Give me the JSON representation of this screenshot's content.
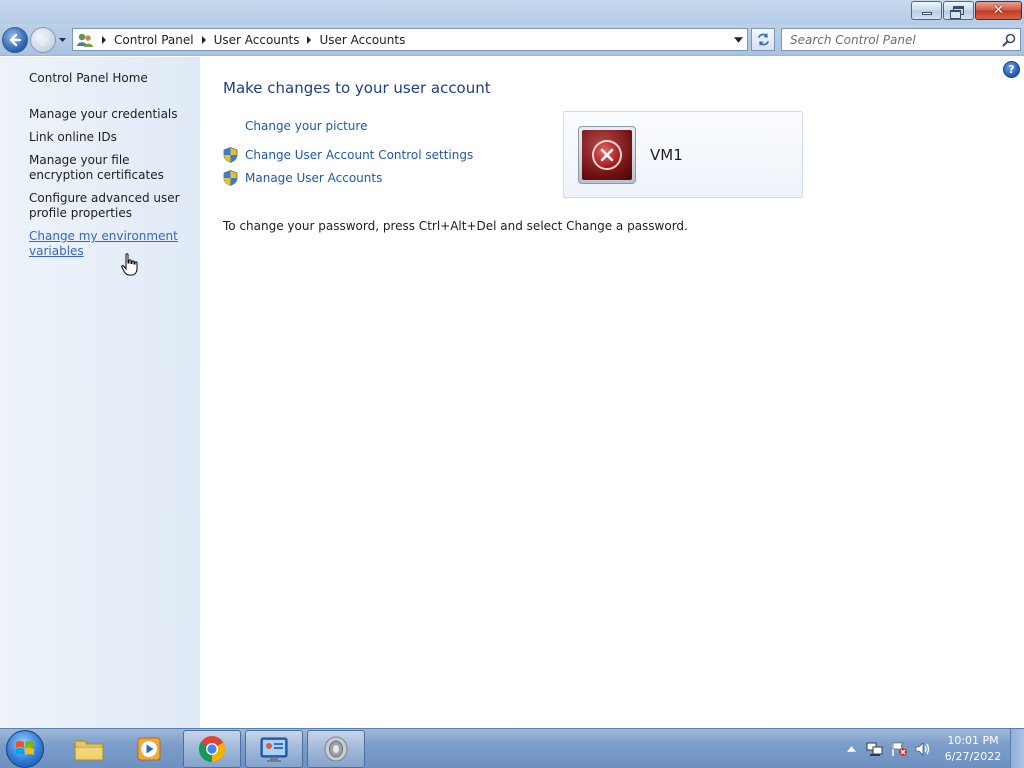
{
  "window": {
    "caption_buttons": {
      "minimize": "minimize",
      "maximize": "restore",
      "close": "close"
    }
  },
  "navigation": {
    "breadcrumbs": [
      "Control Panel",
      "User Accounts",
      "User Accounts"
    ],
    "search_placeholder": "Search Control Panel"
  },
  "sidebar": {
    "home_label": "Control Panel Home",
    "items": [
      {
        "label": "Manage your credentials"
      },
      {
        "label": "Link online IDs"
      },
      {
        "label": "Manage your file encryption certificates"
      },
      {
        "label": "Configure advanced user profile properties"
      },
      {
        "label": "Change my environment variables",
        "hovered": true
      }
    ]
  },
  "main": {
    "heading": "Make changes to your user account",
    "tasks": [
      {
        "label": "Change your picture",
        "shield": false
      },
      {
        "label": "Change User Account Control settings",
        "shield": true
      },
      {
        "label": "Manage User Accounts",
        "shield": true
      }
    ],
    "password_note": "To change your password, press Ctrl+Alt+Del and select Change a password.",
    "user": {
      "name": "VM1",
      "avatar_icon": "error-x-icon"
    }
  },
  "taskbar": {
    "pinned": [
      {
        "name": "file-explorer",
        "icon": "folder-icon"
      },
      {
        "name": "media-player",
        "icon": "media-player-icon"
      },
      {
        "name": "chrome",
        "icon": "chrome-icon",
        "open": true
      },
      {
        "name": "control-panel",
        "icon": "control-panel-icon",
        "open": true
      },
      {
        "name": "audio",
        "icon": "speaker-app-icon",
        "open": true
      }
    ],
    "tray_icons": [
      "show-hidden-icons-arrow",
      "network-icon",
      "action-center-icon",
      "volume-icon"
    ],
    "clock": {
      "time": "10:01 PM",
      "date": "6/27/2022"
    }
  },
  "colors": {
    "link": "#1e5aa8",
    "hover_link": "#3468c4",
    "heading": "#1e3f84",
    "sidebar_bg": "#e3ecf7"
  }
}
